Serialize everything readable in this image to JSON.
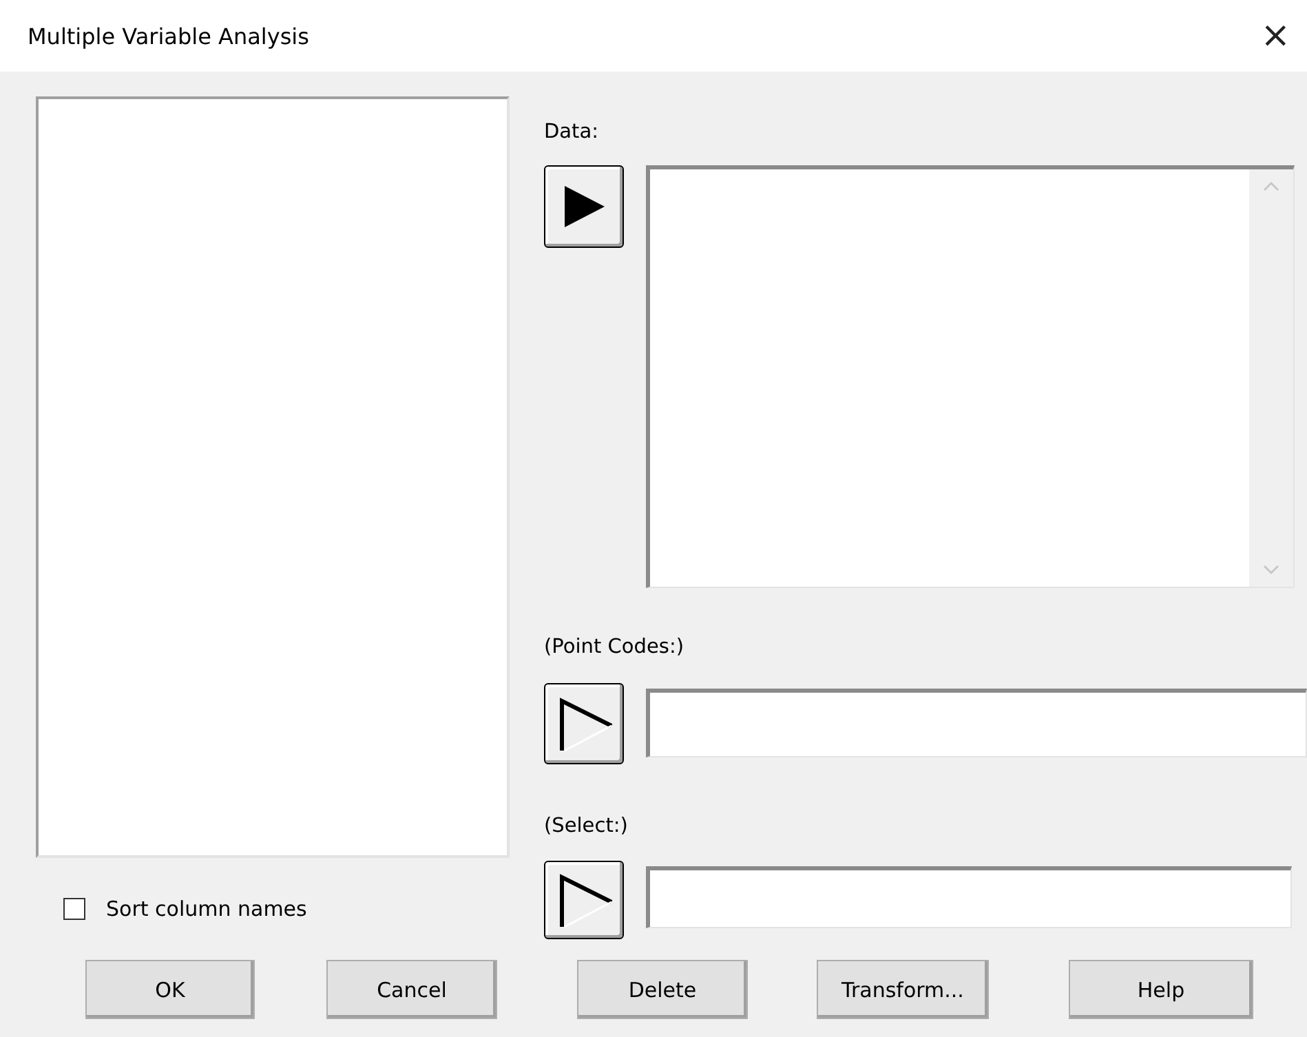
{
  "window": {
    "title": "Multiple Variable Analysis",
    "close": "×"
  },
  "sort_columns": {
    "label": "Sort column names",
    "checked": false
  },
  "fields": [
    {
      "label": "Data:",
      "kind": "list",
      "arrow_enabled": true
    },
    {
      "label": "(Point Codes:)",
      "kind": "text",
      "arrow_enabled": false
    },
    {
      "label": "(Select:)",
      "kind": "text",
      "arrow_enabled": false
    }
  ],
  "buttons": [
    "OK",
    "Cancel",
    "Delete",
    "Transform...",
    "Help"
  ]
}
